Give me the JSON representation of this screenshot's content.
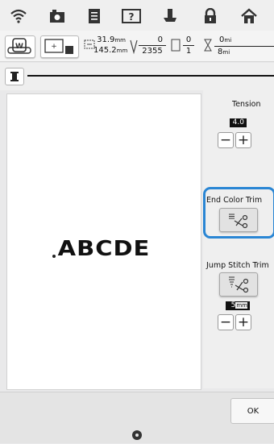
{
  "topbar": {
    "icons": [
      "wifi-icon",
      "camera-icon",
      "document-icon",
      "help-icon",
      "embroidery-foot-icon",
      "lock-icon",
      "home-icon"
    ]
  },
  "info": {
    "width_value": "31.9",
    "height_value": "145.2",
    "size_unit": "mm",
    "needle_current": "0",
    "needle_total": "2355",
    "color_current": "0",
    "color_total": "1",
    "time_current": "0",
    "time_total": "8",
    "time_unit_top": "mi",
    "time_unit_bottom": "mi"
  },
  "preview": {
    "text": "ABCDE"
  },
  "panel": {
    "tension_label": "Tension",
    "tension_value": "4.0",
    "end_color_trim_label": "End Color Trim",
    "jump_stitch_trim_label": "Jump Stitch Trim",
    "jump_value": "5",
    "jump_unit": "mm",
    "minus": "−",
    "plus": "+"
  },
  "bottom": {
    "ok_label": "OK"
  },
  "colors": {
    "highlight": "#2a86d4"
  }
}
